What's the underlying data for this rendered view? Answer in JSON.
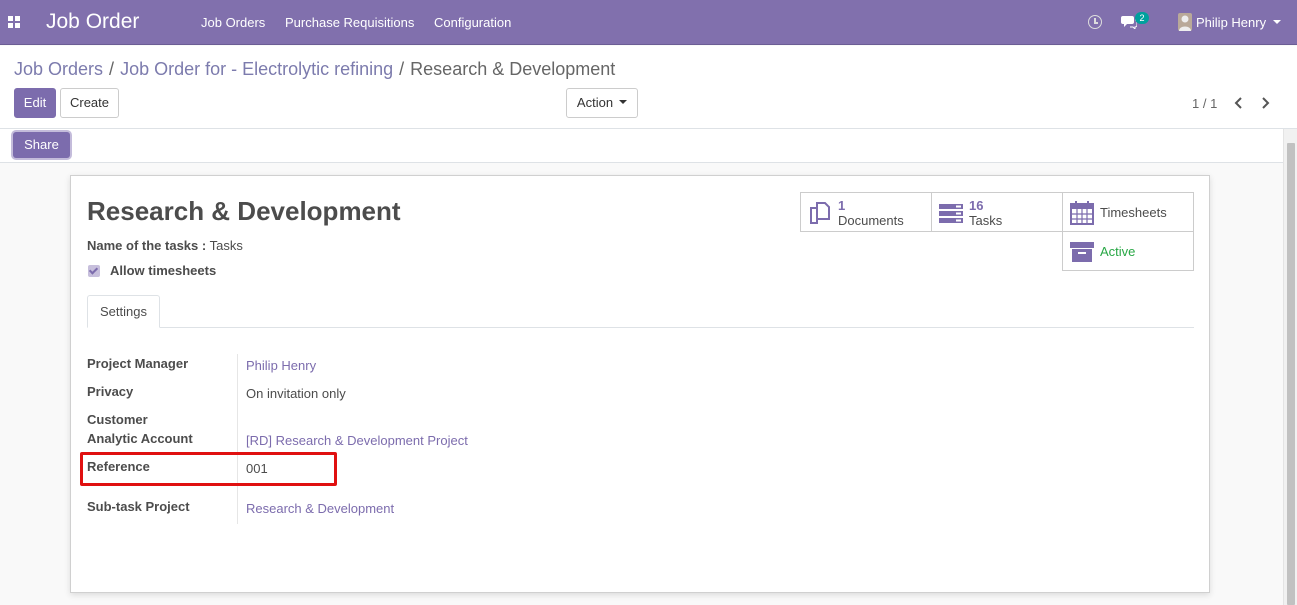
{
  "navbar": {
    "app_title": "Job Order",
    "menu": [
      "Job Orders",
      "Purchase Requisitions",
      "Configuration"
    ],
    "chat_badge": "2",
    "user_name": "Philip Henry",
    "color": "#8170ad"
  },
  "breadcrumb": {
    "items": [
      "Job Orders",
      "Job Order for - Electrolytic refining"
    ],
    "separator": "/",
    "active": "Research & Development"
  },
  "buttons": {
    "edit": "Edit",
    "create": "Create",
    "action": "Action",
    "share": "Share"
  },
  "pager": {
    "value": "1 / 1"
  },
  "record": {
    "title": "Research & Development",
    "tasks_label": "Name of the tasks :",
    "tasks_value": "Tasks",
    "allow_timesheets_label": "Allow timesheets",
    "allow_timesheets_checked": true
  },
  "smart_buttons": {
    "documents": {
      "value": "1",
      "label": "Documents",
      "icon": "documents-icon"
    },
    "tasks": {
      "value": "16",
      "label": "Tasks",
      "icon": "tasks-icon"
    },
    "timesheets": {
      "label": "Timesheets",
      "icon": "calendar-icon"
    },
    "active": {
      "label": "Active",
      "icon": "archive-icon",
      "color": "#28a745"
    }
  },
  "tabs": [
    "Settings"
  ],
  "fields": {
    "project_manager": {
      "label": "Project Manager",
      "value": "Philip Henry"
    },
    "privacy": {
      "label": "Privacy",
      "value": "On invitation only"
    },
    "customer": {
      "label": "Customer",
      "value": ""
    },
    "analytic_account": {
      "label": "Analytic Account",
      "value": "[RD] Research & Development Project"
    },
    "reference": {
      "label": "Reference",
      "value": "001"
    },
    "subtask_project": {
      "label": "Sub-task Project",
      "value": "Research & Development"
    }
  },
  "colors": {
    "primary": "#7c6cad",
    "highlight": "#e01010"
  }
}
